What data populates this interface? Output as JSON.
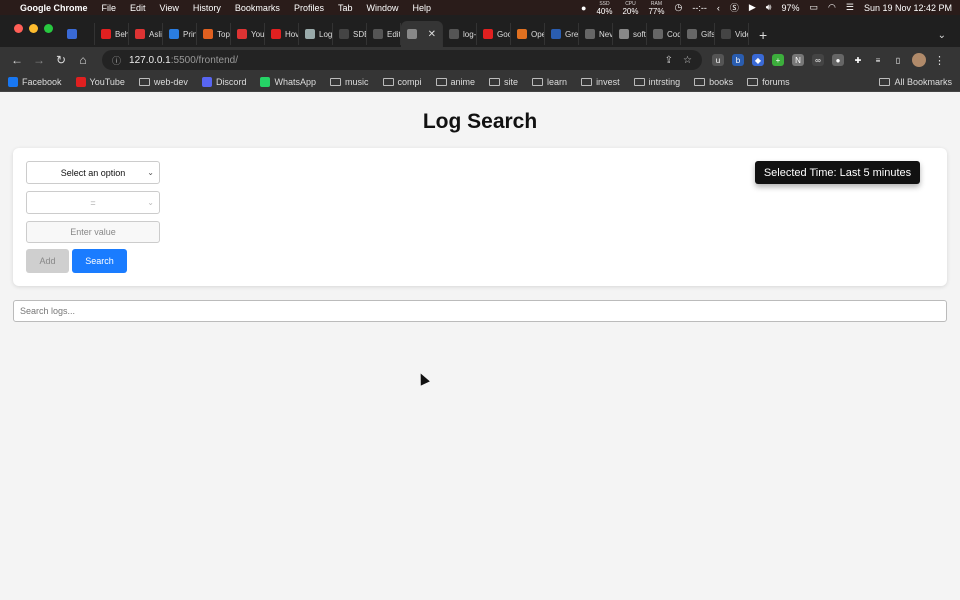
{
  "menubar": {
    "app_name": "Google Chrome",
    "items": [
      "File",
      "Edit",
      "View",
      "History",
      "Bookmarks",
      "Profiles",
      "Tab",
      "Window",
      "Help"
    ],
    "stats": [
      {
        "key": "SSD",
        "value": "40%"
      },
      {
        "key": "CPU",
        "value": "20%"
      },
      {
        "key": "RAM",
        "value": "77%"
      }
    ],
    "timer": "--:--",
    "battery": "97%",
    "datetime": "Sun 19 Nov  12:42 PM"
  },
  "tabs": [
    {
      "label": "",
      "color": "#3a6ad6"
    },
    {
      "label": "Beh",
      "color": "#e02020"
    },
    {
      "label": "Asli",
      "color": "#d33"
    },
    {
      "label": "Prin",
      "color": "#2a7de1"
    },
    {
      "label": "Top",
      "color": "#e06020"
    },
    {
      "label": "You",
      "color": "#d33"
    },
    {
      "label": "Hov",
      "color": "#e02020"
    },
    {
      "label": "Log",
      "color": "#9aa"
    },
    {
      "label": "SDE",
      "color": "#444"
    },
    {
      "label": "Edit",
      "color": "#555"
    },
    {
      "label": "",
      "color": "#888",
      "active": true
    },
    {
      "label": "log-",
      "color": "#555"
    },
    {
      "label": "Goo",
      "color": "#e02020"
    },
    {
      "label": "Ope",
      "color": "#e07020"
    },
    {
      "label": "Gre",
      "color": "#2a5db0"
    },
    {
      "label": "Nev",
      "color": "#666"
    },
    {
      "label": "soft",
      "color": "#888"
    },
    {
      "label": "Cod",
      "color": "#666"
    },
    {
      "label": "Gifs",
      "color": "#666"
    },
    {
      "label": "Vide",
      "color": "#444"
    }
  ],
  "toolbar": {
    "url_host": "127.0.0.1",
    "url_rest": ":5500/frontend/"
  },
  "bookmarks": {
    "items": [
      {
        "label": "Facebook",
        "color": "#1877f2",
        "type": "site"
      },
      {
        "label": "YouTube",
        "color": "#e02020",
        "type": "site"
      },
      {
        "label": "web-dev",
        "type": "folder"
      },
      {
        "label": "Discord",
        "color": "#5865f2",
        "type": "site"
      },
      {
        "label": "WhatsApp",
        "color": "#25d366",
        "type": "site"
      },
      {
        "label": "music",
        "type": "folder"
      },
      {
        "label": "compi",
        "type": "folder"
      },
      {
        "label": "anime",
        "type": "folder"
      },
      {
        "label": "site",
        "type": "folder"
      },
      {
        "label": "learn",
        "type": "folder"
      },
      {
        "label": "invest",
        "type": "folder"
      },
      {
        "label": "intrsting",
        "type": "folder"
      },
      {
        "label": "books",
        "type": "folder"
      },
      {
        "label": "forums",
        "type": "folder"
      }
    ],
    "all_label": "All Bookmarks"
  },
  "page": {
    "title": "Log Search",
    "field_select": "Select an option",
    "operator_select": "=",
    "value_placeholder": "Enter value",
    "add_label": "Add",
    "search_label": "Search",
    "time_badge": "Selected Time: Last 5 minutes",
    "log_search_placeholder": "Search logs..."
  }
}
